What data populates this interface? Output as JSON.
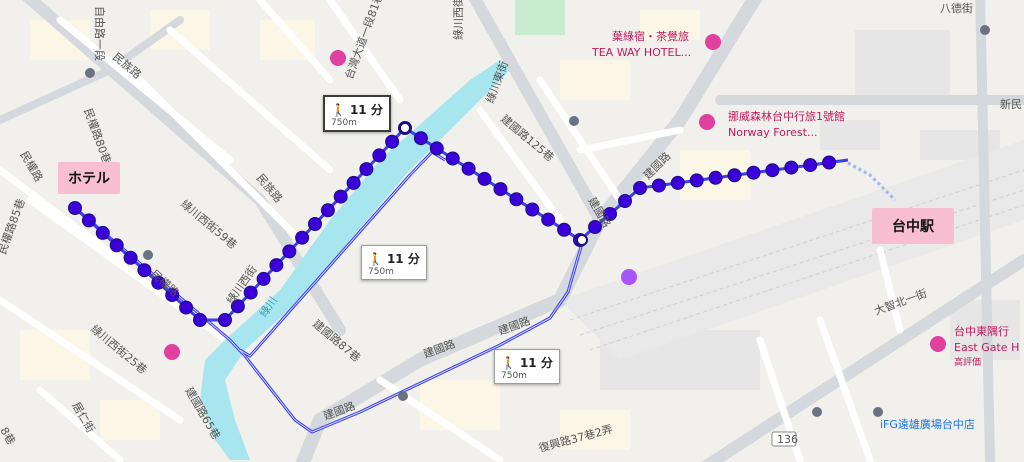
{
  "labels": {
    "hotel": "ホテル",
    "station": "台中駅"
  },
  "callouts": [
    {
      "id": "route-selected",
      "time": "11 分",
      "distance": "750m"
    },
    {
      "id": "route-alt-1",
      "time": "11 分",
      "distance": "750m"
    },
    {
      "id": "route-alt-2",
      "time": "11 分",
      "distance": "750m"
    }
  ],
  "roads": {
    "ziyou": "自由路一段",
    "minzu_top": "民族路",
    "minzu_mid": "民族路",
    "minquan_left": "民權路",
    "minquan": "民權路",
    "lane80": "民權路80巷",
    "lane85": "民權路85巷",
    "luchuan_w": "綠川西街",
    "luchuan_e": "綠川東街",
    "luchuan_w59": "綠川西街59巷",
    "luchuan_w2": "綠川西街",
    "luchuan_w25": "綠川西街25巷",
    "taiwan": "台灣大道一段81巷",
    "jianguo_lane125": "建國路125巷",
    "jianguo_1": "建國路",
    "jianguo_2": "建國路",
    "jianguo_3": "建國路",
    "jianguo_4": "建國路",
    "jianguo_5": "建國路",
    "jianguo_lane87": "建國路87巷",
    "jianguo_lane65": "建國路65巷",
    "juren": "居仁街",
    "dazhi": "大智北一街",
    "bade": "八德街",
    "xinmin": "新民",
    "lane37": "復興路37巷2弄",
    "lane8": "8巷",
    "river": "綠川",
    "shield": "136"
  },
  "pois": {
    "ye_lu_su": "葉綠宿・茶覺旅",
    "tea_way": "TEA WAY HOTEL...",
    "norway_zh": "挪威森林台中行旅1號館",
    "norway_en": "Norway Forest...",
    "east_gate_zh": "台中東隅行",
    "east_gate_en": "East Gate H",
    "east_gate_sub": "高評価",
    "ifg": "iFG遠雄廣場台中店"
  },
  "colors": {
    "route": "#3d3df0",
    "route_dot": "#3b00d9",
    "water": "#a8e6ef",
    "road": "#ffffff",
    "major_road": "#dadce0",
    "pink": "#f8bfd3",
    "poi": "#e040a0"
  }
}
